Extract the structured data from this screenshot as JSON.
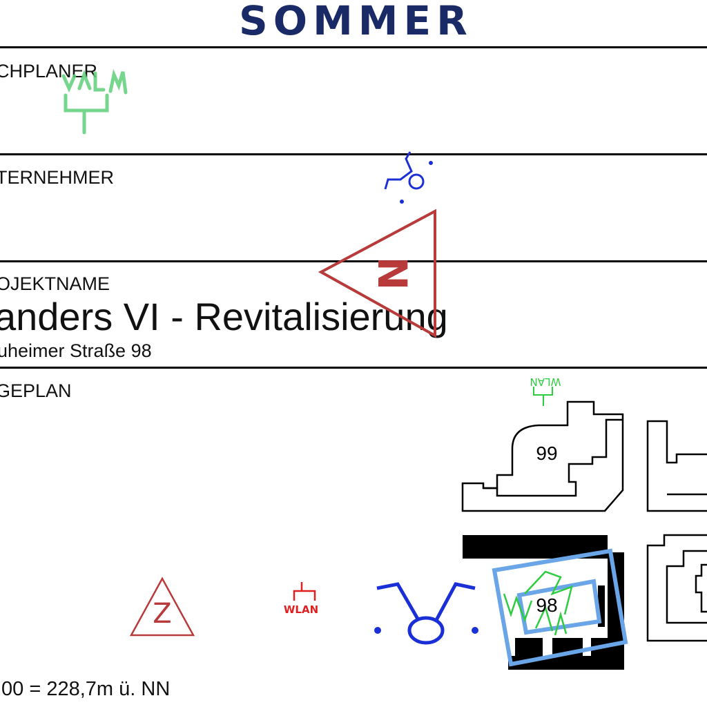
{
  "logo": {
    "text": "SOMMER",
    "color": "#1a2a66"
  },
  "sections": {
    "fachplaner_label": "CHPLANER",
    "unternehmer_label": "TERNEHMER",
    "projektname_label": "OJEKTNAME",
    "project_title": "anders VI - Revitalisierung",
    "project_address": "uheimer Straße 98",
    "lageplan_label": "GEPLAN"
  },
  "site_plan": {
    "building_labels": [
      "99",
      "98"
    ]
  },
  "symbols": {
    "z_symbol_letter": "Z",
    "n_symbol_letter": "N",
    "wlan_red_text": "WLAN",
    "wlan_green_text": "WLAN",
    "wlan_small_green_text": "WLAN",
    "icons": [
      "wlan-antenna-icon",
      "wheelchair-icon",
      "north-triangle-icon",
      "z-triangle-icon",
      "person-symbol-icon"
    ]
  },
  "footer": {
    "elevation_text": ",00 = 228,7m ü. NN"
  },
  "colors": {
    "logo": "#1a2a66",
    "red_symbol": "#b83a3a",
    "blue_symbol": "#1a2fd6",
    "green_symbol": "#2ecc40",
    "light_blue": "#6aa5e8"
  }
}
